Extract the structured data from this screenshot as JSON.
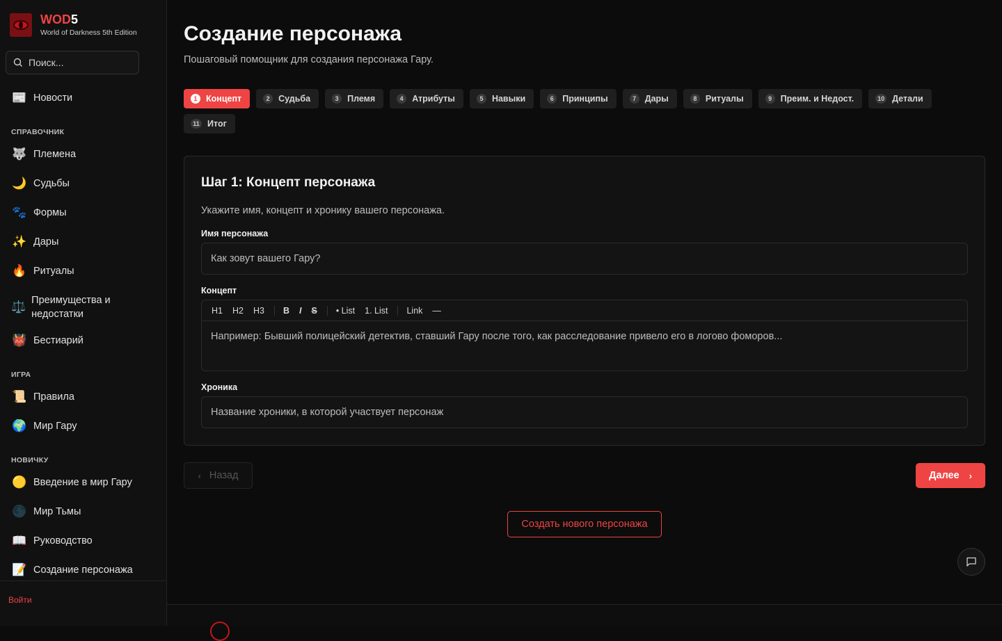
{
  "brand": {
    "title_red": "WOD",
    "title_white": "5",
    "subtitle": "World of Darkness 5th Edition"
  },
  "search": {
    "placeholder": "Поиск..."
  },
  "sidebar": {
    "news": {
      "icon": "📰",
      "label": "Новости"
    },
    "sections": [
      {
        "heading": "СПРАВОЧНИК",
        "items": [
          {
            "icon": "🐺",
            "label": "Племена"
          },
          {
            "icon": "🌙",
            "label": "Судьбы"
          },
          {
            "icon": "🐾",
            "label": "Формы"
          },
          {
            "icon": "✨",
            "label": "Дары"
          },
          {
            "icon": "🔥",
            "label": "Ритуалы"
          },
          {
            "icon": "⚖️",
            "label": "Преимущества и недостатки"
          },
          {
            "icon": "👹",
            "label": "Бестиарий"
          }
        ]
      },
      {
        "heading": "ИГРА",
        "items": [
          {
            "icon": "📜",
            "label": "Правила"
          },
          {
            "icon": "🌍",
            "label": "Мир Гару"
          }
        ]
      },
      {
        "heading": "НОВИЧКУ",
        "items": [
          {
            "icon": "🟡",
            "label": "Введение в мир Гару"
          },
          {
            "icon": "🌑",
            "label": "Мир Тьмы"
          },
          {
            "icon": "📖",
            "label": "Руководство"
          },
          {
            "icon": "📝",
            "label": "Создание персонажа"
          }
        ]
      }
    ],
    "login": "Войти"
  },
  "page": {
    "title": "Создание персонажа",
    "subtitle": "Пошаговый помощник для создания персонажа Гару."
  },
  "steps": [
    {
      "num": "1",
      "label": "Концепт",
      "active": true
    },
    {
      "num": "2",
      "label": "Судьба"
    },
    {
      "num": "3",
      "label": "Племя"
    },
    {
      "num": "4",
      "label": "Атрибуты"
    },
    {
      "num": "5",
      "label": "Навыки"
    },
    {
      "num": "6",
      "label": "Принципы"
    },
    {
      "num": "7",
      "label": "Дары"
    },
    {
      "num": "8",
      "label": "Ритуалы"
    },
    {
      "num": "9",
      "label": "Преим. и Недост."
    },
    {
      "num": "10",
      "label": "Детали"
    },
    {
      "num": "11",
      "label": "Итог"
    }
  ],
  "card": {
    "title": "Шаг 1: Концепт персонажа",
    "description": "Укажите имя, концепт и хронику вашего персонажа.",
    "name_label": "Имя персонажа",
    "name_placeholder": "Как зовут вашего Гару?",
    "concept_label": "Концепт",
    "toolbar": {
      "h1": "H1",
      "h2": "H2",
      "h3": "H3",
      "bold": "B",
      "italic": "I",
      "strike": "S",
      "bullet_list": "• List",
      "ordered_list": "1. List",
      "link": "Link",
      "hr": "—"
    },
    "concept_placeholder": "Например: Бывший полицейский детектив, ставший Гару после того, как расследование привело его в логово фоморов...",
    "chronicle_label": "Хроника",
    "chronicle_placeholder": "Название хроники, в которой участвует персонаж"
  },
  "buttons": {
    "back": "Назад",
    "next": "Далее",
    "new_character": "Создать нового персонажа"
  },
  "colors": {
    "accent": "#ef4444",
    "background": "#0c0c0c",
    "sidebar": "#111111"
  }
}
